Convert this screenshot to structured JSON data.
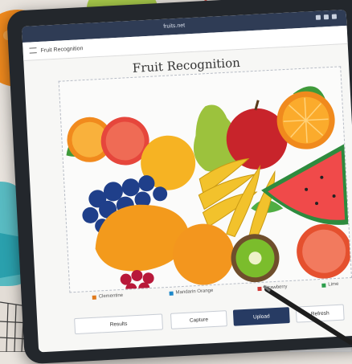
{
  "screen": {
    "url_text": "fruits.net",
    "breadcrumb": "Fruit Recognition",
    "title": "Fruit Recognition"
  },
  "legend": [
    {
      "label": "Clementine",
      "color": "#e07a1c"
    },
    {
      "label": "Mandarin Orange",
      "color": "#1e88c9"
    },
    {
      "label": "Strawberry",
      "color": "#d23a36"
    },
    {
      "label": "Lime",
      "color": "#2d9e4c"
    }
  ],
  "buttons": {
    "results": "Results",
    "capture": "Capture",
    "upload": "Upload",
    "refresh": "Refresh"
  },
  "icons": [
    "menu-icon",
    "wifi-icon",
    "battery-icon"
  ]
}
